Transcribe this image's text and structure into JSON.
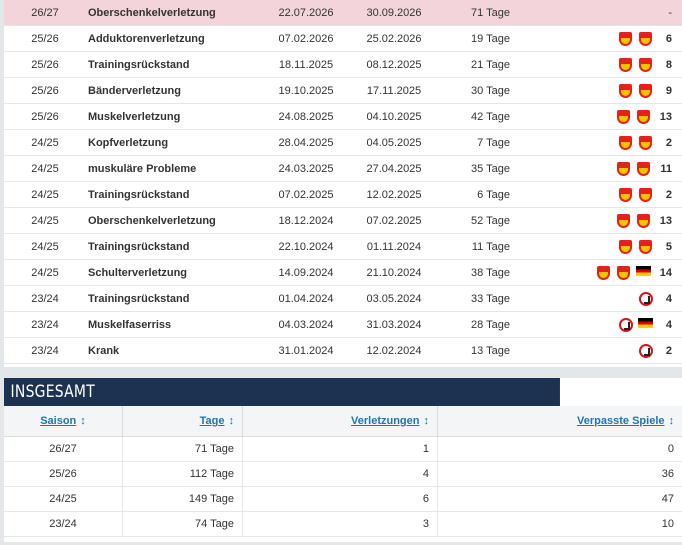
{
  "injuries": [
    {
      "season": "26/27",
      "injury": "Oberschenkelverletzung",
      "from": "22.07.2026",
      "until": "30.09.2026",
      "days": "71 Tage",
      "clubs": [],
      "games": "-",
      "current": true
    },
    {
      "season": "25/26",
      "injury": "Adduktorenverletzung",
      "from": "07.02.2026",
      "until": "25.02.2026",
      "days": "19 Tage",
      "clubs": [
        "vfb",
        "vfb"
      ],
      "games": "6",
      "current": false
    },
    {
      "season": "25/26",
      "injury": "Trainingsrückstand",
      "from": "18.11.2025",
      "until": "08.12.2025",
      "days": "21 Tage",
      "clubs": [
        "vfb",
        "vfb"
      ],
      "games": "8",
      "current": false
    },
    {
      "season": "25/26",
      "injury": "Bänderverletzung",
      "from": "19.10.2025",
      "until": "17.11.2025",
      "days": "30 Tage",
      "clubs": [
        "vfb",
        "vfb"
      ],
      "games": "9",
      "current": false
    },
    {
      "season": "25/26",
      "injury": "Muskelverletzung",
      "from": "24.08.2025",
      "until": "04.10.2025",
      "days": "42 Tage",
      "clubs": [
        "vfb",
        "vfb"
      ],
      "games": "13",
      "current": false
    },
    {
      "season": "24/25",
      "injury": "Kopfverletzung",
      "from": "28.04.2025",
      "until": "04.05.2025",
      "days": "7 Tage",
      "clubs": [
        "vfb",
        "vfb"
      ],
      "games": "2",
      "current": false
    },
    {
      "season": "24/25",
      "injury": "muskuläre Probleme",
      "from": "24.03.2025",
      "until": "27.04.2025",
      "days": "35 Tage",
      "clubs": [
        "vfb",
        "vfb"
      ],
      "games": "11",
      "current": false
    },
    {
      "season": "24/25",
      "injury": "Trainingsrückstand",
      "from": "07.02.2025",
      "until": "12.02.2025",
      "days": "6 Tage",
      "clubs": [
        "vfb",
        "vfb"
      ],
      "games": "2",
      "current": false
    },
    {
      "season": "24/25",
      "injury": "Oberschenkelverletzung",
      "from": "18.12.2024",
      "until": "07.02.2025",
      "days": "52 Tage",
      "clubs": [
        "vfb",
        "vfb"
      ],
      "games": "13",
      "current": false
    },
    {
      "season": "24/25",
      "injury": "Trainingsrückstand",
      "from": "22.10.2024",
      "until": "01.11.2024",
      "days": "11 Tage",
      "clubs": [
        "vfb",
        "vfb"
      ],
      "games": "5",
      "current": false
    },
    {
      "season": "24/25",
      "injury": "Schulterverletzung",
      "from": "14.09.2024",
      "until": "21.10.2024",
      "days": "38 Tage",
      "clubs": [
        "vfb",
        "vfb",
        "flag-de"
      ],
      "games": "14",
      "current": false
    },
    {
      "season": "23/24",
      "injury": "Trainingsrückstand",
      "from": "01.04.2024",
      "until": "03.05.2024",
      "days": "33 Tage",
      "clubs": [
        "koeln"
      ],
      "games": "4",
      "current": false
    },
    {
      "season": "23/24",
      "injury": "Muskelfaserriss",
      "from": "04.03.2024",
      "until": "31.03.2024",
      "days": "28 Tage",
      "clubs": [
        "koeln",
        "flag-de"
      ],
      "games": "4",
      "current": false
    },
    {
      "season": "23/24",
      "injury": "Krank",
      "from": "31.01.2024",
      "until": "12.02.2024",
      "days": "13 Tage",
      "clubs": [
        "koeln"
      ],
      "games": "2",
      "current": false
    }
  ],
  "summary": {
    "title": "INSGESAMT",
    "headers": {
      "season": "Saison",
      "days": "Tage",
      "injuries": "Verletzungen",
      "missed": "Verpasste Spiele"
    },
    "sort_icon": "↕",
    "rows": [
      {
        "season": "26/27",
        "days": "71 Tage",
        "injuries": "1",
        "missed": "0"
      },
      {
        "season": "25/26",
        "days": "112 Tage",
        "injuries": "4",
        "missed": "36"
      },
      {
        "season": "24/25",
        "days": "149 Tage",
        "injuries": "6",
        "missed": "47"
      },
      {
        "season": "23/24",
        "days": "74 Tage",
        "injuries": "3",
        "missed": "10"
      }
    ]
  },
  "colors": {
    "current_row": "#f3d4db",
    "header_bg": "#1d3150",
    "link": "#1d75b3"
  }
}
